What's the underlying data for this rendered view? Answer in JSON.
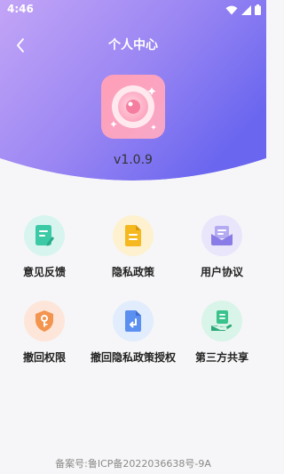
{
  "status_bar": {
    "time": "4:46"
  },
  "header": {
    "title": "个人中心",
    "version": "v1.0.9"
  },
  "menu": [
    {
      "label": "意见反馈",
      "icon": "feedback-icon",
      "circle_color": "#d7f5ee",
      "icon_color": "#3cc9a6"
    },
    {
      "label": "隐私政策",
      "icon": "privacy-document-icon",
      "circle_color": "#fdf1cf",
      "icon_color": "#f5b81e"
    },
    {
      "label": "用户协议",
      "icon": "user-agreement-icon",
      "circle_color": "#e9e6fb",
      "icon_color": "#8a7ce6"
    },
    {
      "label": "撤回权限",
      "icon": "revoke-permission-icon",
      "circle_color": "#fde6d9",
      "icon_color": "#f3944f"
    },
    {
      "label": "撤回隐私政策授权",
      "icon": "revoke-privacy-icon",
      "circle_color": "#e1ecfc",
      "icon_color": "#5b8ff0"
    },
    {
      "label": "第三方共享",
      "icon": "third-party-share-icon",
      "circle_color": "#d9f4e8",
      "icon_color": "#38c28c"
    }
  ],
  "footer": {
    "icp": "备案号:鲁ICP备2022036638号-9A"
  },
  "colors": {
    "header_gradient_start": "#b79af6",
    "header_gradient_end": "#6b63f0",
    "page_background": "#f6f6f8"
  }
}
